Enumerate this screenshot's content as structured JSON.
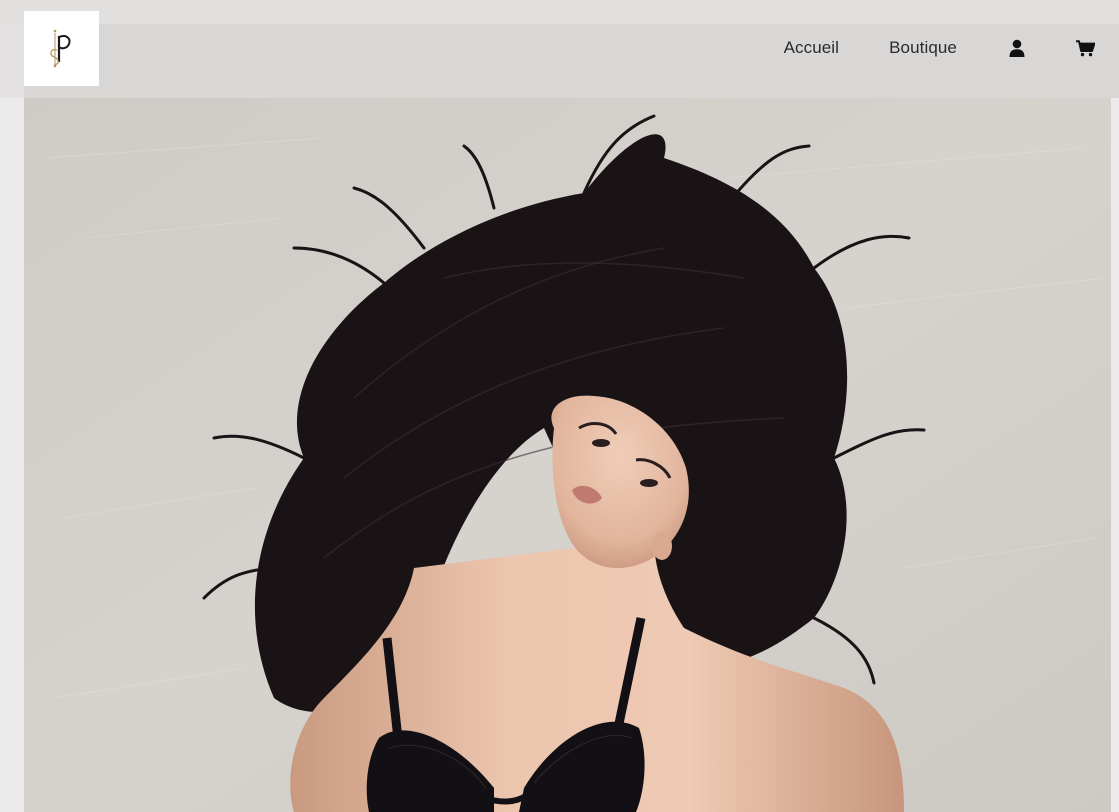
{
  "header": {
    "logo": {
      "icon": "sp-monogram-logo",
      "gold": "#b39a5b",
      "ink": "#1a1a1a"
    },
    "nav": [
      {
        "label": "Accueil"
      },
      {
        "label": "Boutique"
      }
    ],
    "account_icon": "user-icon",
    "cart_icon": "shopping-cart-icon"
  },
  "hero": {
    "image": "model-flying-hair-lingerie-photo",
    "background_color": "#d2cec9",
    "hair_color": "#1a1316",
    "skin_color": "#e9c2aa"
  }
}
